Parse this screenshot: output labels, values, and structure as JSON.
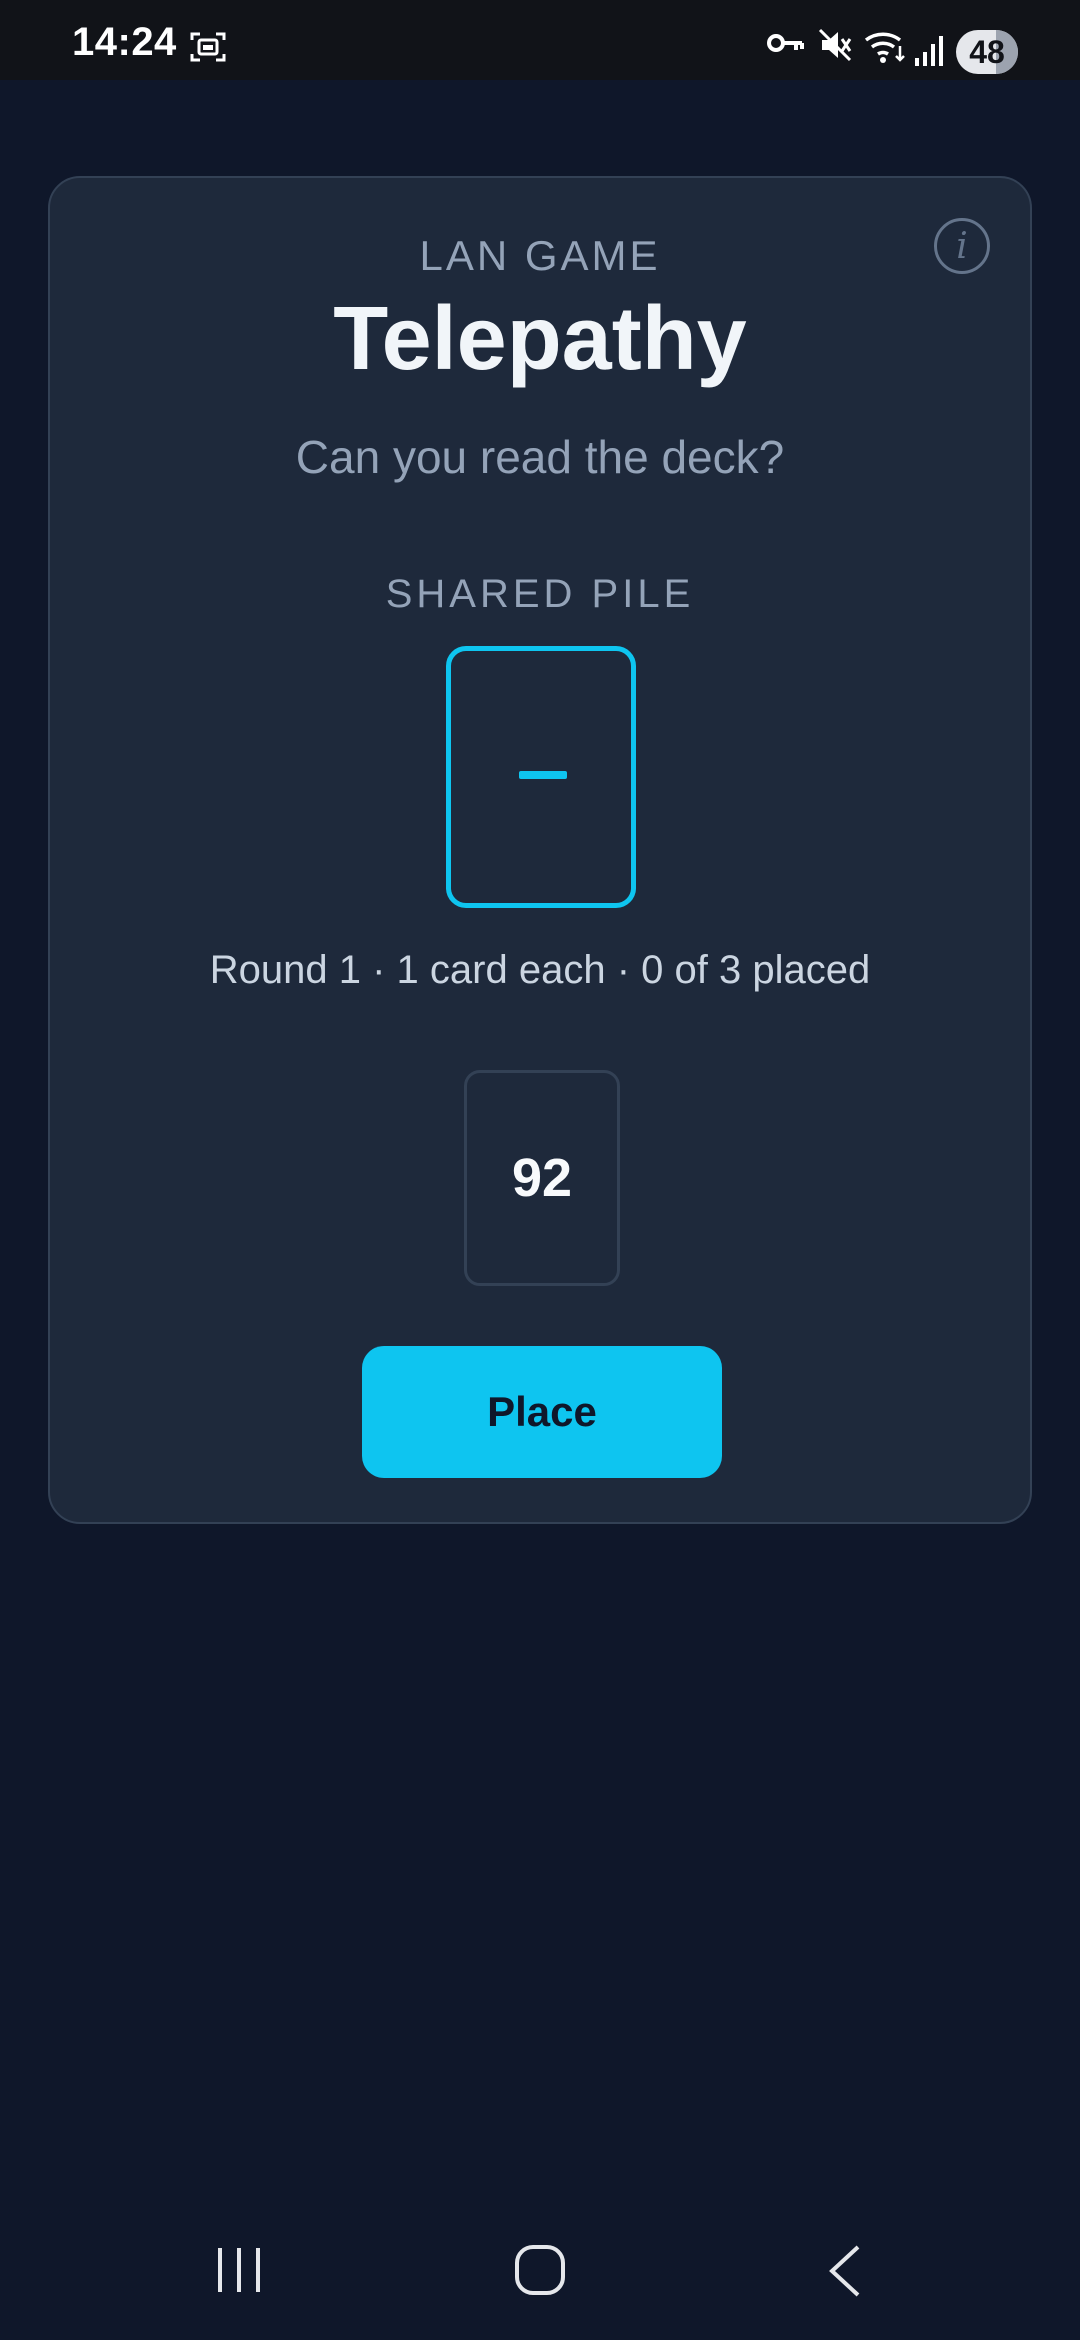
{
  "status_bar": {
    "time": "14:24",
    "battery": "48",
    "icons": [
      "screenshot-icon",
      "vpn-key-icon",
      "mute-icon",
      "wifi-icon",
      "signal-icon"
    ]
  },
  "game": {
    "kicker": "LAN GAME",
    "title": "Telepathy",
    "subtitle": "Can you read the deck?",
    "pile_label": "SHARED PILE",
    "pile_top": "–",
    "round_info": "Round 1 · 1 card each · 0 of 3 placed",
    "hand_card": "92",
    "place_label": "Place",
    "info_icon": "info-icon",
    "accent_color": "#0ec5f0"
  },
  "nav_bar": {
    "icons": [
      "recents-icon",
      "home-icon",
      "back-icon"
    ]
  }
}
